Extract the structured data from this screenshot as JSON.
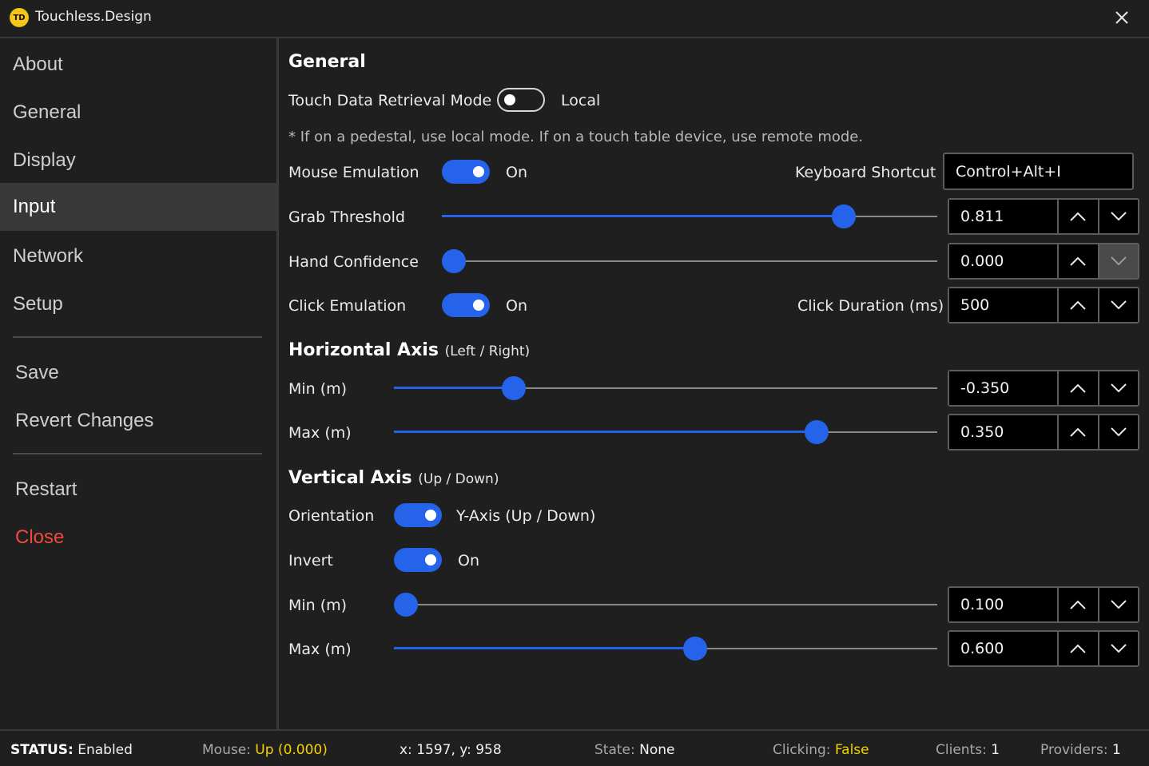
{
  "app": {
    "logo_text": "TD",
    "title": "Touchless.Design"
  },
  "sidebar": {
    "nav": [
      {
        "label": "About"
      },
      {
        "label": "General"
      },
      {
        "label": "Display"
      },
      {
        "label": "Input",
        "active": true
      },
      {
        "label": "Network"
      },
      {
        "label": "Setup"
      }
    ],
    "actions": {
      "save": "Save",
      "revert": "Revert Changes",
      "restart": "Restart",
      "close": "Close"
    }
  },
  "general": {
    "heading": "General",
    "touch_mode_label": "Touch Data Retrieval Mode",
    "touch_mode_value": "Local",
    "touch_mode_on": false,
    "note": "* If on a pedestal, use local mode. If on a touch table device, use remote mode.",
    "mouse_emulation": {
      "label": "Mouse Emulation",
      "value": "On",
      "on": true
    },
    "keyboard_shortcut": {
      "label": "Keyboard Shortcut",
      "value": "Control+Alt+I"
    },
    "grab_threshold": {
      "label": "Grab Threshold",
      "value": "0.811",
      "fraction": 0.811
    },
    "hand_confidence": {
      "label": "Hand Confidence",
      "value": "0.000",
      "fraction": 0.0
    },
    "click_emulation": {
      "label": "Click Emulation",
      "value": "On",
      "on": true
    },
    "click_duration": {
      "label": "Click Duration (ms)",
      "value": "500"
    }
  },
  "horizontal": {
    "heading": "Horizontal Axis",
    "sub": "(Left / Right)",
    "min": {
      "label": "Min (m)",
      "value": "-0.350",
      "fraction": 0.22
    },
    "max": {
      "label": "Max (m)",
      "value": "0.350",
      "fraction": 0.778
    }
  },
  "vertical": {
    "heading": "Vertical Axis",
    "sub": "(Up / Down)",
    "orientation": {
      "label": "Orientation",
      "value": "Y-Axis (Up / Down)",
      "on": true
    },
    "invert": {
      "label": "Invert",
      "value": "On",
      "on": true
    },
    "min": {
      "label": "Min (m)",
      "value": "0.100",
      "fraction": 0.022
    },
    "max": {
      "label": "Max (m)",
      "value": "0.600",
      "fraction": 0.554
    }
  },
  "status": {
    "status_label": "STATUS:",
    "status_value": "Enabled",
    "mouse_label": "Mouse:",
    "mouse_value": "Up (0.000)",
    "coords": "x: 1597, y:  958",
    "state_label": "State:",
    "state_value": "None",
    "clicking_label": "Clicking:",
    "clicking_value": "False",
    "clients_label": "Clients:",
    "clients_value": "1",
    "providers_label": "Providers:",
    "providers_value": "1"
  },
  "colors": {
    "accent": "#2563eb",
    "danger": "#f04a3c",
    "highlight": "#f5d300",
    "logo": "#f5c518"
  },
  "icons": {
    "close": "close-icon",
    "up": "chevron-up-icon",
    "down": "chevron-down-icon"
  }
}
